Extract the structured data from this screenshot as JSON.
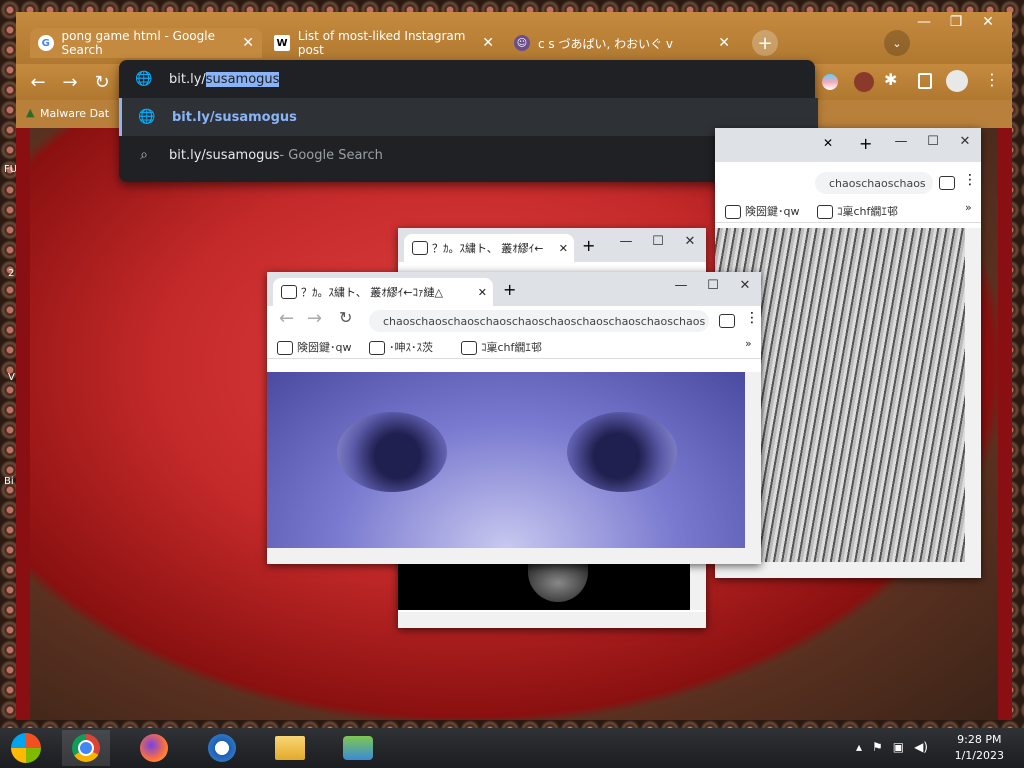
{
  "browser": {
    "tabs": [
      {
        "label": "pong game html - Google Search",
        "icon": "google-icon",
        "active": true
      },
      {
        "label": "List of most-liked Instagram post",
        "icon": "wikipedia-icon",
        "active": false
      },
      {
        "label": "c s づあぱい, わおいぐ v",
        "icon": "anime-avatar-icon",
        "active": false
      }
    ],
    "window_controls": [
      "minimize",
      "maximize",
      "close"
    ],
    "address_bar": {
      "text_prefix": "bit.ly/",
      "text_selected": "susamogus"
    },
    "bookmarks": [
      {
        "label": "Malware Dat"
      }
    ]
  },
  "omnibox": {
    "suggestions": [
      {
        "icon": "globe-icon",
        "main": "bit.ly/susamogus",
        "secondary": ""
      },
      {
        "icon": "search-icon",
        "main": "bit.ly/susamogus",
        "secondary": " - Google Search"
      }
    ]
  },
  "popups": {
    "right": {
      "url": "chaoschaoschaos",
      "bookmarks": [
        "険圀鍵･qw",
        "ｺ稟chf繝ｴ邨"
      ]
    },
    "middle": {
      "tab": "？ｶ。ｽ繍ト、 叢ｵ繆ｲ←"
    },
    "front": {
      "tab": "？ｶ。ｽ繍ト、 叢ｵ繆ｲ←ｺｧ縺△",
      "url": "chaoschaoschaoschaoschaoschaoschaoschaoschaoschaos",
      "bookmarks": [
        "険圀鍵･qw",
        "･呻ｽ･ｽ茨",
        "ｺ稟chf繝ｴ邨"
      ]
    }
  },
  "taskbar": {
    "items": [
      "start-orb",
      "chrome",
      "firefox",
      "internet-explorer",
      "file-explorer",
      "network-people"
    ],
    "time": "9:28 PM",
    "date": "1/1/2023"
  },
  "desktop_labels": [
    "FU",
    "2",
    "V",
    "Bi"
  ],
  "colors": {
    "title_bar": "#c58a3e",
    "omnibox_bg": "#202124",
    "omnibox_link": "#8ab4f8",
    "page_red": "#c52a2a"
  }
}
